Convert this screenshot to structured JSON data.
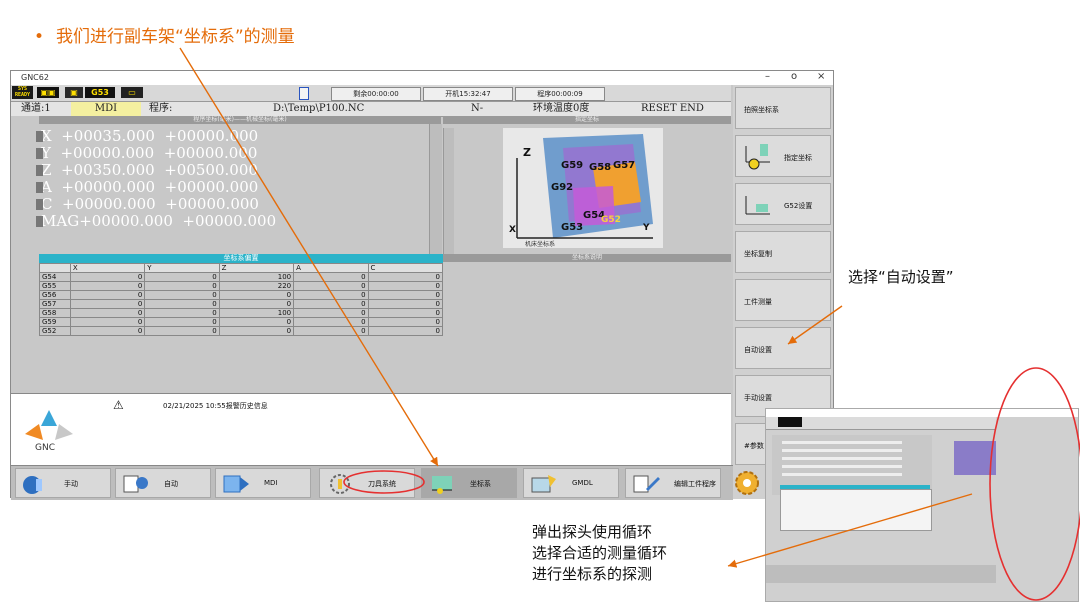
{
  "slide": {
    "title": "我们进行副车架“坐标系”的测量",
    "annotation_auto": "选择“自动设置”",
    "annotation_probe_line1": "弹出探头使用循环",
    "annotation_probe_line2": "选择合适的测量循环",
    "annotation_probe_line3": "进行坐标系的探测"
  },
  "window": {
    "title": "GNC62",
    "minimize": "–",
    "maximize": "o",
    "close": "×"
  },
  "statusbar": {
    "ready_line1": "SYS",
    "ready_line2": "READY",
    "g53_label": "G53",
    "remaining": "剩余00:00:00",
    "power_on": "开机15:32:47",
    "run_time": "程序00:00:09"
  },
  "infobar": {
    "channel": "通道:1",
    "mode": "MDI",
    "program_label": "程序:",
    "program_path": "D:\\Temp\\P100.NC",
    "n_label": "N-",
    "env_temp": "环境温度0度",
    "reset_status": "RESET END"
  },
  "coords": {
    "header": "程序坐标(毫米)——机械坐标(毫米)",
    "rows": [
      {
        "axis": "X",
        "prog": "+00035.000",
        "mach": "+00000.000"
      },
      {
        "axis": "Y",
        "prog": "+00000.000",
        "mach": "+00000.000"
      },
      {
        "axis": "Z",
        "prog": "+00350.000",
        "mach": "+00500.000"
      },
      {
        "axis": "A",
        "prog": "+00000.000",
        "mach": "+00000.000"
      },
      {
        "axis": "C",
        "prog": "+00000.000",
        "mach": "+00000.000"
      },
      {
        "axis": "MAG",
        "prog": "+00000.000",
        "mach": "+00000.000"
      }
    ]
  },
  "schematic": {
    "header": "指定坐标",
    "g59": "G59",
    "g58": "G58",
    "g57": "G57",
    "g92": "G92",
    "g54": "G54",
    "g53": "G53",
    "g52": "G52",
    "z_axis": "Z",
    "x_axis": "X",
    "y_axis": "Y",
    "machine_label": "机床坐标系",
    "footer": "坐标系说明"
  },
  "offset_table": {
    "title": "坐标系偏置",
    "headers": [
      "",
      "X",
      "Y",
      "Z",
      "A",
      "C"
    ],
    "rows": [
      {
        "name": "G54",
        "x": "0",
        "y": "0",
        "z": "100",
        "a": "0",
        "c": "0"
      },
      {
        "name": "G55",
        "x": "0",
        "y": "0",
        "z": "220",
        "a": "0",
        "c": "0"
      },
      {
        "name": "G56",
        "x": "0",
        "y": "0",
        "z": "0",
        "a": "0",
        "c": "0"
      },
      {
        "name": "G57",
        "x": "0",
        "y": "0",
        "z": "0",
        "a": "0",
        "c": "0"
      },
      {
        "name": "G58",
        "x": "0",
        "y": "0",
        "z": "100",
        "a": "0",
        "c": "0"
      },
      {
        "name": "G59",
        "x": "0",
        "y": "0",
        "z": "0",
        "a": "0",
        "c": "0"
      },
      {
        "name": "G52",
        "x": "0",
        "y": "0",
        "z": "0",
        "a": "0",
        "c": "0"
      }
    ]
  },
  "message": {
    "text": "02/21/2025 10:55报警历史信息",
    "logo_text": "GNC"
  },
  "bottom_buttons": [
    {
      "label": "手动"
    },
    {
      "label": "自动"
    },
    {
      "label": "MDI"
    },
    {
      "label": "刀具系统"
    },
    {
      "label": "坐标系"
    },
    {
      "label": "GMDL"
    },
    {
      "label": "编辑工件程序"
    }
  ],
  "side_buttons": [
    {
      "label": "拍照坐标系"
    },
    {
      "label": "指定坐标"
    },
    {
      "label": "G52设置"
    },
    {
      "label": "坐标复制"
    },
    {
      "label": "工件测量"
    },
    {
      "label": "自动设置"
    },
    {
      "label": "手动设置"
    },
    {
      "label": "#参数"
    }
  ],
  "colors": {
    "accent_orange": "#e46c0a",
    "annotation_red": "#e53030",
    "table_header_teal": "#2bb3c9",
    "mdi_yellow": "#f4f0a0"
  }
}
